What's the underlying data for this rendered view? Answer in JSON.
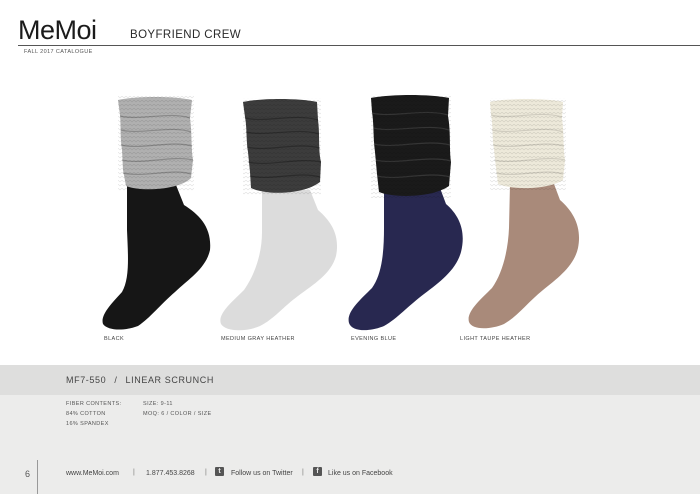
{
  "header": {
    "brand": "MeMoi",
    "category": "BOYFRIEND CREW",
    "subtitle": "FALL 2017 CATALOGUE"
  },
  "products": [
    {
      "caption": "BLACK",
      "cuff_color": "#b0b0b0",
      "foot_color": "#161616"
    },
    {
      "caption": "MEDIUM GRAY HEATHER",
      "cuff_color": "#3c3c3c",
      "foot_color": "#dcdcdc"
    },
    {
      "caption": "EVENING BLUE",
      "cuff_color": "#1a1a1a",
      "foot_color": "#282850"
    },
    {
      "caption": "LIGHT TAUPE HEATHER",
      "cuff_color": "#ede9da",
      "foot_color": "#a98a7a"
    }
  ],
  "style": {
    "code": "MF7-550",
    "separator": "/",
    "name": "LINEAR SCRUNCH"
  },
  "specs": {
    "fiber_label": "FIBER CONTENTS:",
    "fiber_1": "84% COTTON",
    "fiber_2": "16% SPANDEX",
    "size": "SIZE: 9-11",
    "moq": "MOQ: 6 / COLOR / SIZE"
  },
  "footer": {
    "page_number": "6",
    "website": "www.MeMoi.com",
    "phone": "1.877.453.8268",
    "twitter": "Follow us on Twitter",
    "facebook": "Like us on Facebook",
    "separator": "|",
    "twitter_glyph": "t",
    "facebook_glyph": "f"
  }
}
